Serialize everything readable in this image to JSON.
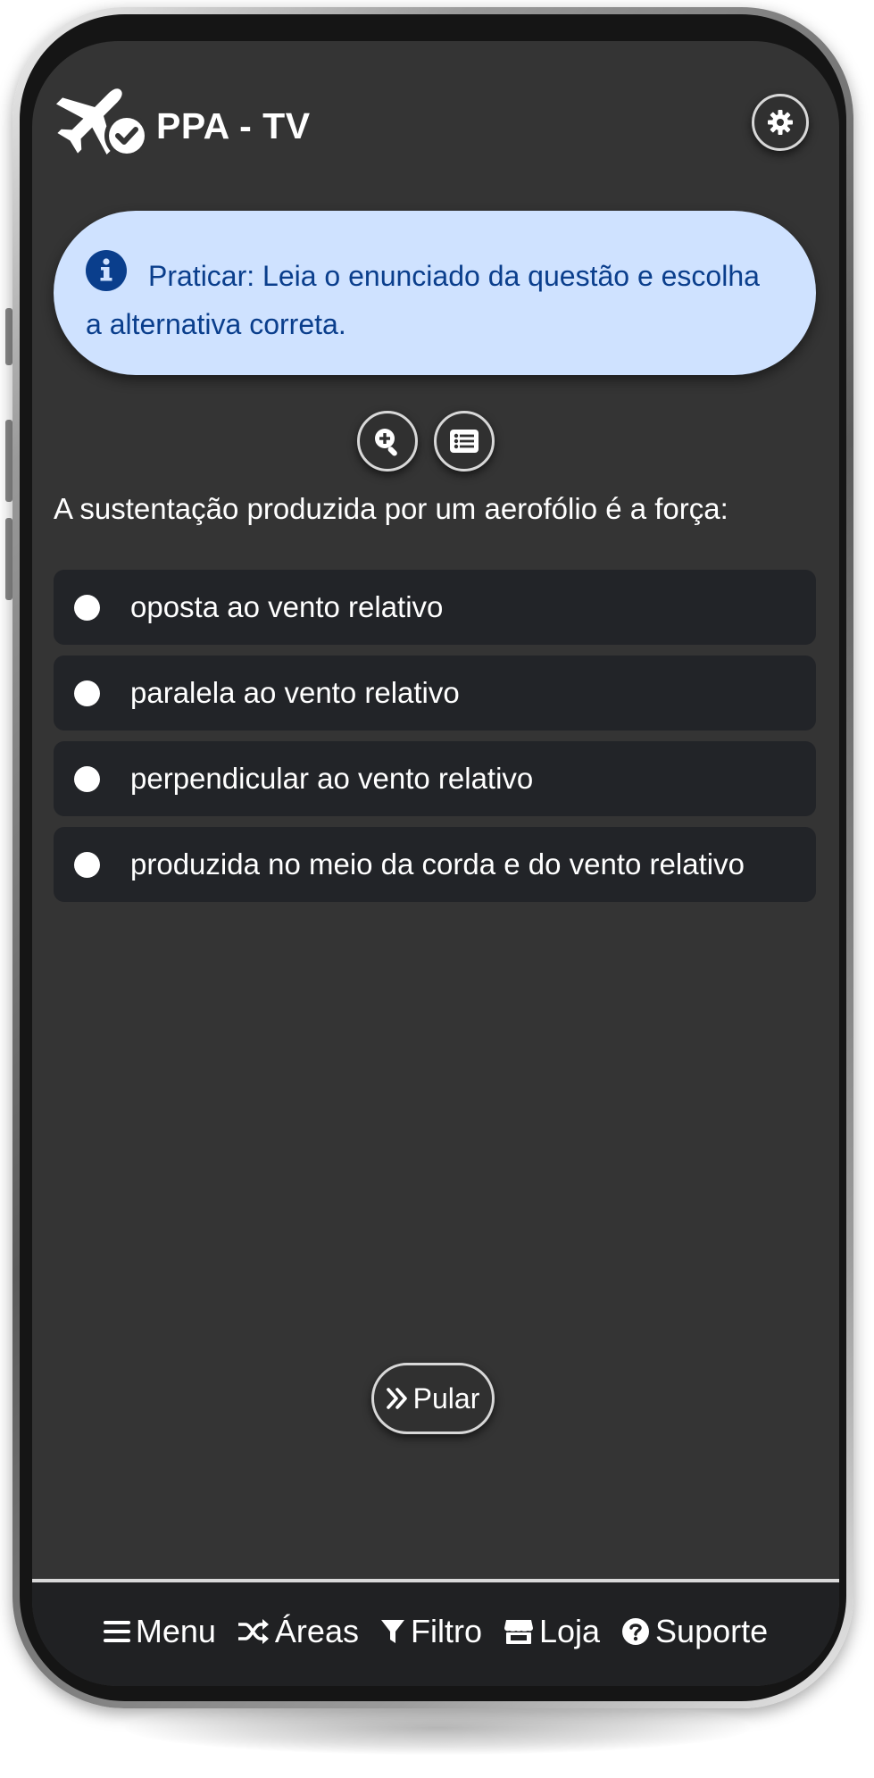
{
  "header": {
    "title": "PPA - TV"
  },
  "alert": {
    "text": "Praticar: Leia o enunciado da questão e escolha a alternativa correta."
  },
  "question": {
    "text": "A sustentação produzida por um aerofólio é a força:"
  },
  "options": [
    {
      "label": "oposta ao vento relativo"
    },
    {
      "label": "paralela ao vento relativo"
    },
    {
      "label": "perpendicular ao vento relativo"
    },
    {
      "label": "produzida no meio da corda e do vento relativo"
    }
  ],
  "skip": {
    "label": "Pular"
  },
  "footer": {
    "items": [
      {
        "label": "Menu",
        "icon": "bars-icon"
      },
      {
        "label": "Áreas",
        "icon": "shuffle-icon"
      },
      {
        "label": "Filtro",
        "icon": "filter-icon"
      },
      {
        "label": "Loja",
        "icon": "store-icon"
      },
      {
        "label": "Suporte",
        "icon": "question-circle-icon"
      }
    ]
  },
  "colors": {
    "screen_bg": "#343434",
    "alert_bg": "#cfe2ff",
    "alert_text": "#0a3e8c",
    "option_bg": "#222428",
    "footer_bg": "#202123"
  }
}
